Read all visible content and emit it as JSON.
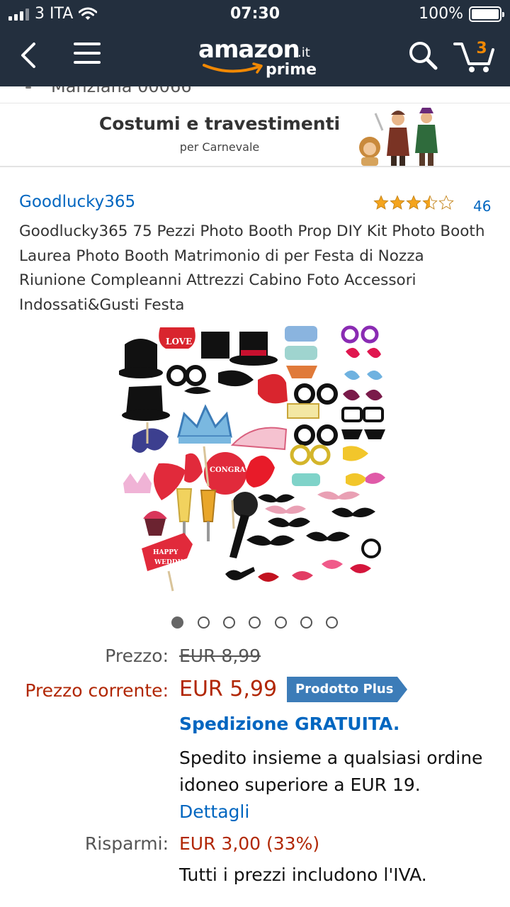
{
  "status_bar": {
    "carrier": "3 ITA",
    "time": "07:30",
    "battery": "100%"
  },
  "header": {
    "logo_word": "amazon",
    "logo_tld": ".it",
    "logo_prime": "prime",
    "cart_count": "3",
    "icons": [
      "back-arrow-icon",
      "menu-icon",
      "search-icon",
      "cart-icon"
    ]
  },
  "address_strip": {
    "text": "Manziana 00066"
  },
  "promo": {
    "title": "Costumi e travestimenti",
    "subtitle": "per Carnevale"
  },
  "product": {
    "brand": "Goodlucky365",
    "rating": 3.5,
    "rating_max": 5,
    "review_count": "46",
    "title": "Goodlucky365 75 Pezzi Photo Booth Prop DIY Kit Photo Booth Laurea Photo Booth Matrimonio di per Festa di Nozza Riunione Compleanni Attrezzi Cabino Foto Accessori Indossati&Gusti Festa",
    "image_count": 7,
    "active_image_index": 0
  },
  "pricing": {
    "price_label": "Prezzo:",
    "price_value": "EUR 8,99",
    "current_label": "Prezzo corrente:",
    "current_value": "EUR 5,99",
    "badge": "Prodotto Plus",
    "shipping": "Spedizione GRATUITA.",
    "shipping_note": "Spedito insieme a qualsiasi ordine idoneo superiore a EUR 19.",
    "shipping_link": "Dettagli",
    "savings_label": "Risparmi:",
    "savings_value": "EUR 3,00 (33%)",
    "vat_note": "Tutti i prezzi includono l'IVA."
  },
  "colors": {
    "header_bg": "#232f3e",
    "link_blue": "#0066c0",
    "price_red": "#b12704",
    "badge_blue": "#3c7cb8",
    "star_orange": "#f4a41d"
  }
}
